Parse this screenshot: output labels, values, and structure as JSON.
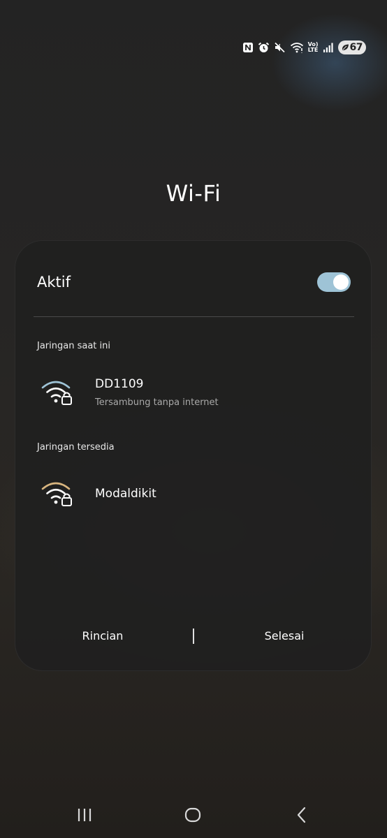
{
  "status_bar": {
    "icons": [
      "nfc-icon",
      "alarm-icon",
      "mute-icon",
      "wifi-icon",
      "volte-icon",
      "signal-icon"
    ],
    "lte_top": "Vo)",
    "lte_bottom": "LTE",
    "battery_level": "67"
  },
  "page": {
    "title": "Wi-Fi"
  },
  "dialog": {
    "toggle_label": "Aktif",
    "toggle_on": true,
    "current_section": "Jaringan saat ini",
    "current_network": {
      "name": "DD1109",
      "status": "Tersambung tanpa internet",
      "icon": "wifi-lock-icon"
    },
    "available_section": "Jaringan tersedia",
    "available_networks": [
      {
        "name": "Modaldikit",
        "icon": "wifi-lock-icon"
      }
    ],
    "footer": {
      "details_label": "Rincian",
      "done_label": "Selesai"
    }
  },
  "colors": {
    "toggle_accent": "#9ec3d6",
    "current_wifi": "#9ec3d6",
    "available_wifi": "#d8b57f",
    "card_background": "#202020"
  },
  "nav_bar": {
    "icons": [
      "recent-apps-icon",
      "home-icon",
      "back-icon"
    ]
  }
}
